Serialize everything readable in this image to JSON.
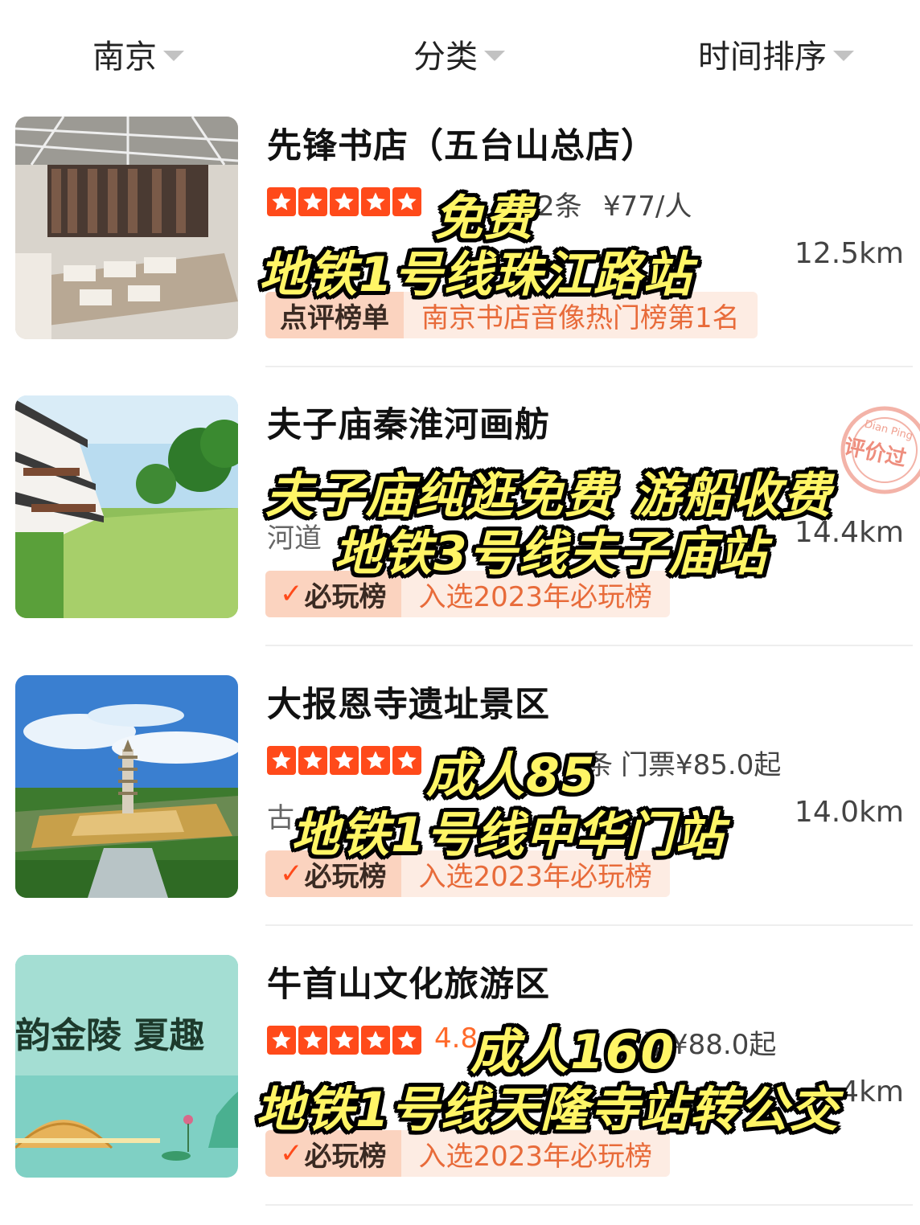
{
  "filters": [
    {
      "label": "南京"
    },
    {
      "label": "分类"
    },
    {
      "label": "时间排序"
    }
  ],
  "items": [
    {
      "title": "先锋书店（五台山总店）",
      "rating_stars": 5,
      "reviews_fragment": "2条",
      "price": "¥77/人",
      "subtitle": "",
      "distance": "12.5km",
      "badge_head": "点评榜单",
      "badge_text": "南京书店音像热门榜第1名",
      "overlay": [
        "免费",
        "地铁1号线珠江路站"
      ]
    },
    {
      "title": "夫子庙秦淮河画舫",
      "subtitle": "河道",
      "distance": "14.4km",
      "badge_head": "必玩榜",
      "badge_text": "入选2023年必玩榜",
      "stamp_top": "Dian Ping",
      "stamp_text": "评价过",
      "overlay": [
        "夫子庙纯逛免费 游船收费",
        "地铁3号线夫子庙站"
      ]
    },
    {
      "title": "大报恩寺遗址景区",
      "rating_stars": 5,
      "reviews_fragment": "条",
      "price": "门票¥85.0起",
      "subtitle": "古",
      "distance": "14.0km",
      "badge_head": "必玩榜",
      "badge_text": "入选2023年必玩榜",
      "overlay": [
        "成人85",
        "地铁1号线中华门站"
      ]
    },
    {
      "title": "牛首山文化旅游区",
      "rating_stars": 5,
      "rating_value": "4.8",
      "price": "票¥88.0起",
      "distance": ".4km",
      "badge_head": "必玩榜",
      "badge_text": "入选2023年必玩榜",
      "thumb_text": "韵金陵 夏趣",
      "overlay": [
        "成人160",
        "地铁1号线天隆寺站转公交"
      ]
    }
  ],
  "colors": {
    "accent": "#ff4a1a",
    "badge_bg": "#fdece3",
    "badge_head_bg": "#fbd3bf",
    "caption": "#fff566"
  }
}
